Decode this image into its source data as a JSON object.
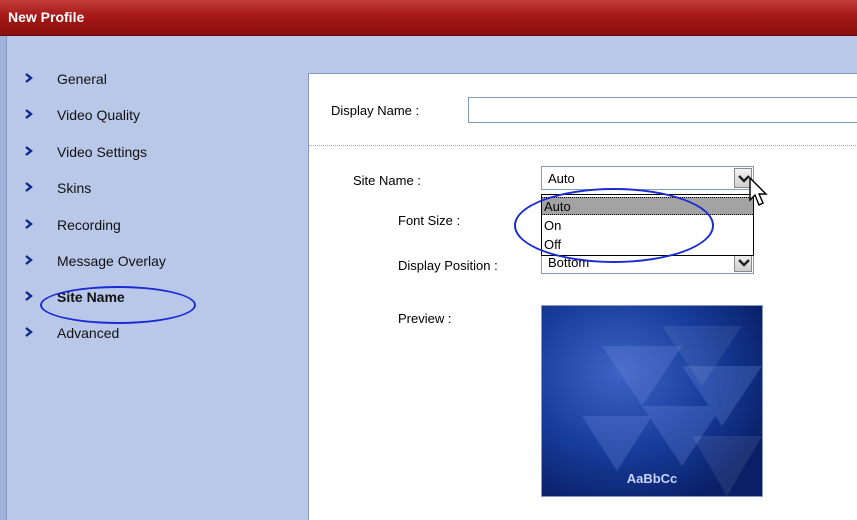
{
  "window": {
    "title": "New Profile"
  },
  "sidebar": {
    "items": [
      {
        "label": "General",
        "active": false
      },
      {
        "label": "Video Quality",
        "active": false
      },
      {
        "label": "Video Settings",
        "active": false
      },
      {
        "label": "Skins",
        "active": false
      },
      {
        "label": "Recording",
        "active": false
      },
      {
        "label": "Message Overlay",
        "active": false
      },
      {
        "label": "Site Name",
        "active": true
      },
      {
        "label": "Advanced",
        "active": false
      }
    ]
  },
  "form": {
    "display_name_label": "Display Name :",
    "display_name_value": "",
    "site_name_label": "Site Name :",
    "site_name_value": "Auto",
    "site_name_options": [
      "Auto",
      "On",
      "Off"
    ],
    "font_size_label": "Font Size :",
    "display_position_label": "Display Position :",
    "display_position_value": "Bottom",
    "preview_label": "Preview :",
    "preview_sample_text": "AaBbCc"
  },
  "colors": {
    "titlebar": "#a51816",
    "background": "#b9c8e8",
    "highlight": "#1a2bd6",
    "chevron": "#0c2a8a"
  }
}
